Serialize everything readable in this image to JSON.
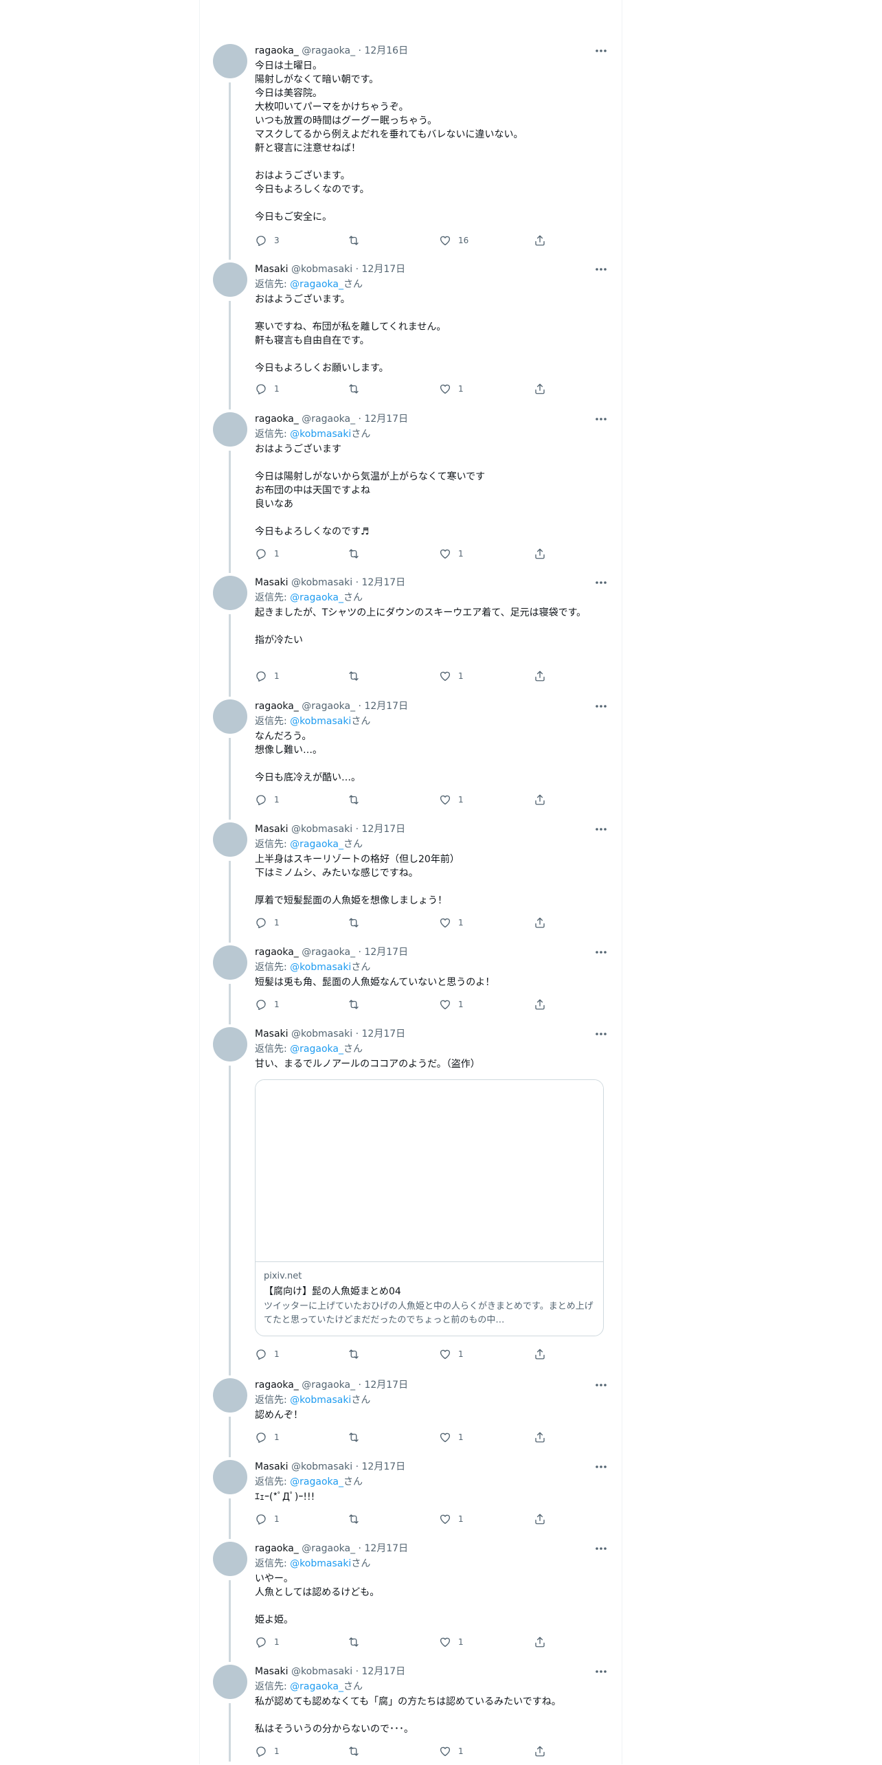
{
  "icons": {
    "reply": "reply-icon",
    "retweet": "retweet-icon",
    "like": "heart-icon",
    "share": "share-icon",
    "more": "more-icon"
  },
  "tweets": [
    {
      "name": "ragaoka_",
      "handle": "@ragaoka_",
      "date": "12月16日",
      "reply_to": null,
      "text": "今日は土曜日。\n陽射しがなくて暗い朝です。\n今日は美容院。\n大枚叩いてパーマをかけちゃうぞ。\nいつも放置の時間はグーグー眠っちゃう。\nマスクしてるから例えよだれを垂れてもバレないに違いない。\n鼾と寝言に注意せねば！\n\nおはようございます。\n今日もよろしくなのです。\n\n今日もご安全に。",
      "replies": "3",
      "retweets": "",
      "likes": "16"
    },
    {
      "name": "Masaki",
      "handle": "@kobmasaki",
      "date": "12月17日",
      "reply_to": {
        "prefix": "返信先: ",
        "handle": "@ragaoka_",
        "suffix": "さん"
      },
      "text": "おはようございます。\n\n寒いですね、布団が私を離してくれません。\n鼾も寝言も自由自在です。\n\n今日もよろしくお願いします。",
      "replies": "1",
      "retweets": "",
      "likes": "1"
    },
    {
      "name": "ragaoka_",
      "handle": "@ragaoka_",
      "date": "12月17日",
      "reply_to": {
        "prefix": "返信先: ",
        "handle": "@kobmasaki",
        "suffix": "さん"
      },
      "text": "おはようございます\n\n今日は陽射しがないから気温が上がらなくて寒いです\nお布団の中は天国ですよね\n良いなあ\n\n今日もよろしくなのです♬",
      "replies": "1",
      "retweets": "",
      "likes": "1"
    },
    {
      "name": "Masaki",
      "handle": "@kobmasaki",
      "date": "12月17日",
      "reply_to": {
        "prefix": "返信先: ",
        "handle": "@ragaoka_",
        "suffix": "さん"
      },
      "text": "起きましたが、Tシャツの上にダウンのスキーウエア着て、足元は寝袋です。\n\n指が冷たい",
      "replies": "1",
      "retweets": "",
      "likes": "1"
    },
    {
      "name": "ragaoka_",
      "handle": "@ragaoka_",
      "date": "12月17日",
      "reply_to": {
        "prefix": "返信先: ",
        "handle": "@kobmasaki",
        "suffix": "さん"
      },
      "text": "なんだろう。\n想像し難い…。\n\n今日も底冷えが酷い…。",
      "replies": "1",
      "retweets": "",
      "likes": "1"
    },
    {
      "name": "Masaki",
      "handle": "@kobmasaki",
      "date": "12月17日",
      "reply_to": {
        "prefix": "返信先: ",
        "handle": "@ragaoka_",
        "suffix": "さん"
      },
      "text": "上半身はスキーリゾートの格好（但し20年前）\n下はミノムシ、みたいな感じですね。\n\n厚着で短髪髭面の人魚姫を想像しましょう！",
      "replies": "1",
      "retweets": "",
      "likes": "1"
    },
    {
      "name": "ragaoka_",
      "handle": "@ragaoka_",
      "date": "12月17日",
      "reply_to": {
        "prefix": "返信先: ",
        "handle": "@kobmasaki",
        "suffix": "さん"
      },
      "text": "短髪は兎も角、髭面の人魚姫なんていないと思うのよ！",
      "replies": "1",
      "retweets": "",
      "likes": "1"
    },
    {
      "name": "Masaki",
      "handle": "@kobmasaki",
      "date": "12月17日",
      "reply_to": {
        "prefix": "返信先: ",
        "handle": "@ragaoka_",
        "suffix": "さん"
      },
      "text": "甘い、まるでルノアールのココアのようだ。（盗作）",
      "card": {
        "domain": "pixiv.net",
        "title": "【腐向け】髭の人魚姫まとめ04",
        "description": "ツイッターに上げていたおひげの人魚姫と中の人らくがきまとめです。まとめ上げてたと思っていたけどまだだったのでちょっと前のもの中…"
      },
      "replies": "1",
      "retweets": "",
      "likes": "1"
    },
    {
      "name": "ragaoka_",
      "handle": "@ragaoka_",
      "date": "12月17日",
      "reply_to": {
        "prefix": "返信先: ",
        "handle": "@kobmasaki",
        "suffix": "さん"
      },
      "text": "認めんぞ！",
      "replies": "1",
      "retweets": "",
      "likes": "1"
    },
    {
      "name": "Masaki",
      "handle": "@kobmasaki",
      "date": "12月17日",
      "reply_to": {
        "prefix": "返信先: ",
        "handle": "@ragaoka_",
        "suffix": "さん"
      },
      "text": "ｴｪｰ(*ﾟДﾟ)ｰ!!!",
      "replies": "1",
      "retweets": "",
      "likes": "1"
    },
    {
      "name": "ragaoka_",
      "handle": "@ragaoka_",
      "date": "12月17日",
      "reply_to": {
        "prefix": "返信先: ",
        "handle": "@kobmasaki",
        "suffix": "さん"
      },
      "text": "いやー。\n人魚としては認めるけども。\n\n姫よ姫。",
      "replies": "1",
      "retweets": "",
      "likes": "1"
    },
    {
      "name": "Masaki",
      "handle": "@kobmasaki",
      "date": "12月17日",
      "reply_to": {
        "prefix": "返信先: ",
        "handle": "@ragaoka_",
        "suffix": "さん"
      },
      "text": "私が認めても認めなくても「腐」の方たちは認めているみたいですね。\n\n私はそういうの分からないので･･･。",
      "replies": "1",
      "retweets": "",
      "likes": "1"
    }
  ]
}
